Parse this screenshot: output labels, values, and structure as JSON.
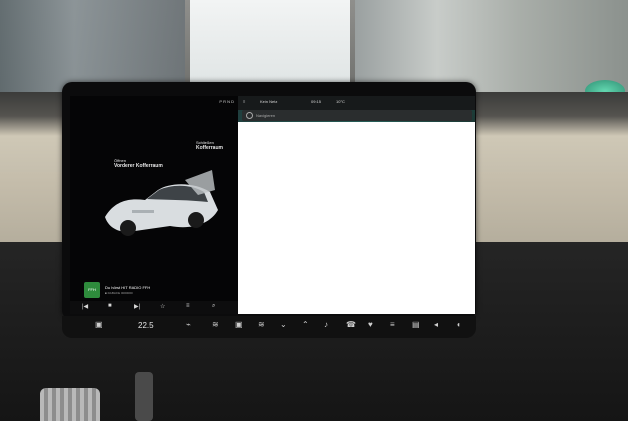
{
  "status_bar": {
    "text": "P R N D"
  },
  "map": {
    "top_left": "≡",
    "top_center": "Kein Netz",
    "top_time": "09:15",
    "top_temp": "10°C",
    "search_placeholder": "Navigieren"
  },
  "vehicle": {
    "front_label_small": "Öffnen",
    "front_label": "Vorderer Kofferraum",
    "rear_label_small": "Schließen",
    "rear_label": "Kofferraum"
  },
  "radio": {
    "logo": "FFH",
    "title": "Du hörst HIT RADIO FFH",
    "subtitle": "■ DABLIFE 0000000"
  },
  "media_controls": [
    "|◀",
    "■",
    "▶|",
    "☆",
    "≡",
    "⌕"
  ],
  "control_strip": {
    "car_icon": "▣",
    "temperature": "22.5",
    "controls": [
      "⌁",
      "≋",
      "▣",
      "≋",
      "⌄",
      "⌃",
      "♪",
      "☎",
      "♥",
      "≡",
      "▤",
      "◂",
      "◖"
    ]
  }
}
